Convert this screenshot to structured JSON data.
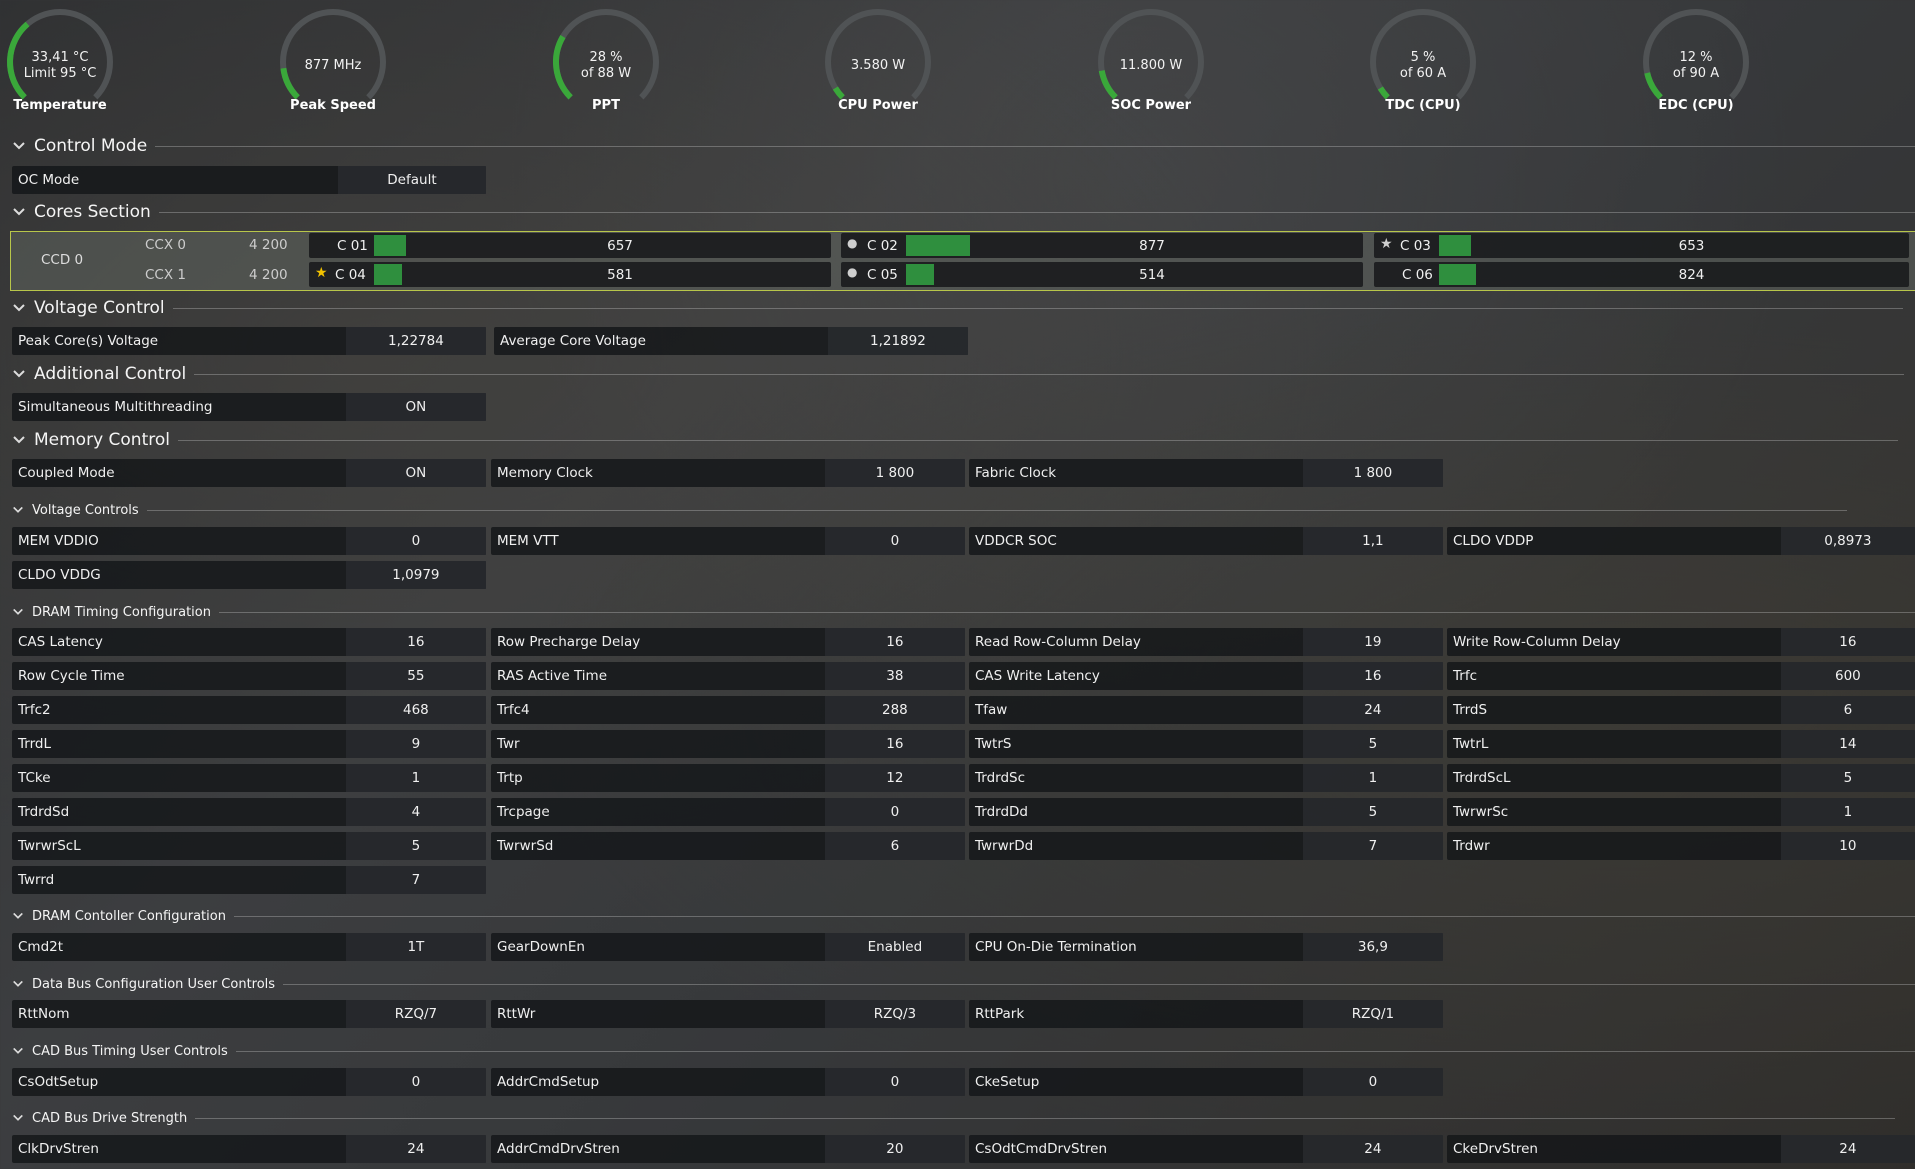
{
  "gauges": [
    {
      "line1": "33,41 °C",
      "line2": "Limit 95 °C",
      "label": "Temperature",
      "fraction": 0.35
    },
    {
      "line1": "877  MHz",
      "line2": "",
      "label": "Peak Speed",
      "fraction": 0.14
    },
    {
      "line1": "28 %",
      "line2": "of 88 W",
      "label": "PPT",
      "fraction": 0.28
    },
    {
      "line1": "3.580 W",
      "line2": "",
      "label": "CPU Power",
      "fraction": 0.05
    },
    {
      "line1": "11.800 W",
      "line2": "",
      "label": "SOC Power",
      "fraction": 0.13
    },
    {
      "line1": "5 %",
      "line2": "of 60 A",
      "label": "TDC (CPU)",
      "fraction": 0.05
    },
    {
      "line1": "12 %",
      "line2": "of 90 A",
      "label": "EDC (CPU)",
      "fraction": 0.12
    }
  ],
  "sections": {
    "control_mode": "Control Mode",
    "cores": "Cores Section",
    "voltage_control": "Voltage Control",
    "additional_control": "Additional Control",
    "memory_control": "Memory Control",
    "voltage_controls": "Voltage Controls",
    "dram_timing": "DRAM Timing Configuration",
    "dram_controller": "DRAM Contoller Configuration",
    "data_bus": "Data Bus Configuration User Controls",
    "cad_timing": "CAD Bus Timing User Controls",
    "cad_drive": "CAD Bus Drive Strength"
  },
  "control_mode": {
    "oc_label": "OC Mode",
    "oc_value": "Default"
  },
  "cores": {
    "ccd": "CCD 0",
    "ccx": [
      {
        "name": "CCX 0",
        "freq": "4 200"
      },
      {
        "name": "CCX 1",
        "freq": "4 200"
      }
    ],
    "list": [
      {
        "name": "C 01",
        "value": "657",
        "marker": "",
        "fill": 0.07
      },
      {
        "name": "C 02",
        "value": "877",
        "marker": "●",
        "fill": 0.14
      },
      {
        "name": "C 03",
        "value": "653",
        "marker": "★",
        "fill": 0.07
      },
      {
        "name": "C 04",
        "value": "581",
        "marker": "★",
        "fill": 0.06
      },
      {
        "name": "C 05",
        "value": "514",
        "marker": "●",
        "fill": 0.06
      },
      {
        "name": "C 06",
        "value": "824",
        "marker": "",
        "fill": 0.08
      }
    ],
    "marker_colors": {
      "gold": "#f2c200",
      "grey": "#cfcfcf"
    }
  },
  "voltage": {
    "peak_label": "Peak Core(s) Voltage",
    "peak_value": "1,22784",
    "avg_label": "Average Core Voltage",
    "avg_value": "1,21892"
  },
  "additional": {
    "smt_label": "Simultaneous Multithreading",
    "smt_value": "ON"
  },
  "memory": {
    "coupled_label": "Coupled Mode",
    "coupled_value": "ON",
    "memclk_label": "Memory Clock",
    "memclk_value": "1 800",
    "fclk_label": "Fabric Clock",
    "fclk_value": "1 800"
  },
  "voltage_controls": [
    {
      "label": "MEM VDDIO",
      "value": "0"
    },
    {
      "label": "MEM VTT",
      "value": "0"
    },
    {
      "label": "VDDCR SOC",
      "value": "1,1"
    },
    {
      "label": "CLDO VDDP",
      "value": "0,8973"
    },
    {
      "label": "CLDO VDDG",
      "value": "1,0979"
    }
  ],
  "dram_timing": [
    {
      "label": "CAS Latency",
      "value": "16"
    },
    {
      "label": "Row Precharge Delay",
      "value": "16"
    },
    {
      "label": "Read Row-Column Delay",
      "value": "19"
    },
    {
      "label": "Write Row-Column Delay",
      "value": "16"
    },
    {
      "label": "Row Cycle Time",
      "value": "55"
    },
    {
      "label": "RAS Active Time",
      "value": "38"
    },
    {
      "label": "CAS Write Latency",
      "value": "16"
    },
    {
      "label": "Trfc",
      "value": "600"
    },
    {
      "label": "Trfc2",
      "value": "468"
    },
    {
      "label": "Trfc4",
      "value": "288"
    },
    {
      "label": "Tfaw",
      "value": "24"
    },
    {
      "label": "TrrdS",
      "value": "6"
    },
    {
      "label": "TrrdL",
      "value": "9"
    },
    {
      "label": "Twr",
      "value": "16"
    },
    {
      "label": "TwtrS",
      "value": "5"
    },
    {
      "label": "TwtrL",
      "value": "14"
    },
    {
      "label": "TCke",
      "value": "1"
    },
    {
      "label": "Trtp",
      "value": "12"
    },
    {
      "label": "TrdrdSc",
      "value": "1"
    },
    {
      "label": "TrdrdScL",
      "value": "5"
    },
    {
      "label": "TrdrdSd",
      "value": "4"
    },
    {
      "label": "Trcpage",
      "value": "0"
    },
    {
      "label": "TrdrdDd",
      "value": "5"
    },
    {
      "label": "TwrwrSc",
      "value": "1"
    },
    {
      "label": "TwrwrScL",
      "value": "5"
    },
    {
      "label": "TwrwrSd",
      "value": "6"
    },
    {
      "label": "TwrwrDd",
      "value": "7"
    },
    {
      "label": "Trdwr",
      "value": "10"
    },
    {
      "label": "Twrrd",
      "value": "7"
    }
  ],
  "dram_controller": [
    {
      "label": "Cmd2t",
      "value": "1T"
    },
    {
      "label": "GearDownEn",
      "value": "Enabled"
    },
    {
      "label": "CPU On-Die Termination",
      "value": "36,9"
    }
  ],
  "data_bus": [
    {
      "label": "RttNom",
      "value": "RZQ/7"
    },
    {
      "label": "RttWr",
      "value": "RZQ/3"
    },
    {
      "label": "RttPark",
      "value": "RZQ/1"
    }
  ],
  "cad_timing": [
    {
      "label": "CsOdtSetup",
      "value": "0"
    },
    {
      "label": "AddrCmdSetup",
      "value": "0"
    },
    {
      "label": "CkeSetup",
      "value": "0"
    }
  ],
  "cad_drive": [
    {
      "label": "ClkDrvStren",
      "value": "24"
    },
    {
      "label": "AddrCmdDrvStren",
      "value": "20"
    },
    {
      "label": "CsOdtCmdDrvStren",
      "value": "24"
    },
    {
      "label": "CkeDrvStren",
      "value": "24"
    }
  ],
  "colors": {
    "gauge_active": "#3aa83a",
    "gauge_track": "#505355",
    "core_bar": "#2f8f3e",
    "highlight_border": "#b8c64a"
  }
}
